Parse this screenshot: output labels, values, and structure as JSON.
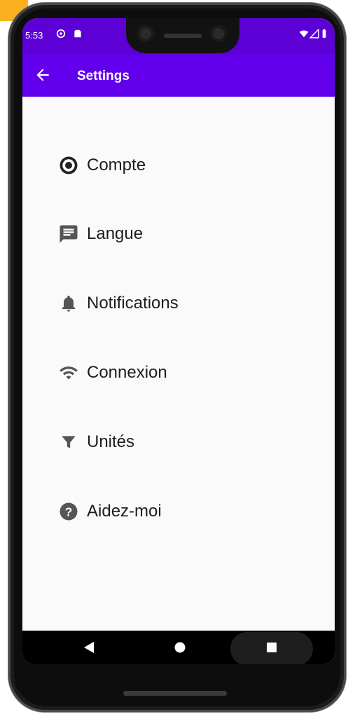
{
  "status_bar": {
    "time": "5:53",
    "icons": [
      "at-sign-icon",
      "sd-card-icon",
      "wifi-icon",
      "signal-icon",
      "battery-icon"
    ]
  },
  "app_bar": {
    "title": "Settings",
    "back_icon": "arrow-back-icon",
    "color": "#6200ee"
  },
  "settings": {
    "items": [
      {
        "label": "Compte",
        "icon": "account-circle-icon"
      },
      {
        "label": "Langue",
        "icon": "chat-bubble-icon"
      },
      {
        "label": "Notifications",
        "icon": "bell-icon"
      },
      {
        "label": "Connexion",
        "icon": "wifi-icon"
      },
      {
        "label": "Unités",
        "icon": "filter-icon"
      },
      {
        "label": "Aidez-moi",
        "icon": "help-icon"
      }
    ]
  },
  "nav_bar": {
    "buttons": [
      "back-triangle-icon",
      "home-circle-icon",
      "recents-square-icon"
    ]
  },
  "colors": {
    "status_bar": "#5c00d6",
    "icon": "#555555",
    "text": "#1d1d1d",
    "background": "#fafafa"
  }
}
